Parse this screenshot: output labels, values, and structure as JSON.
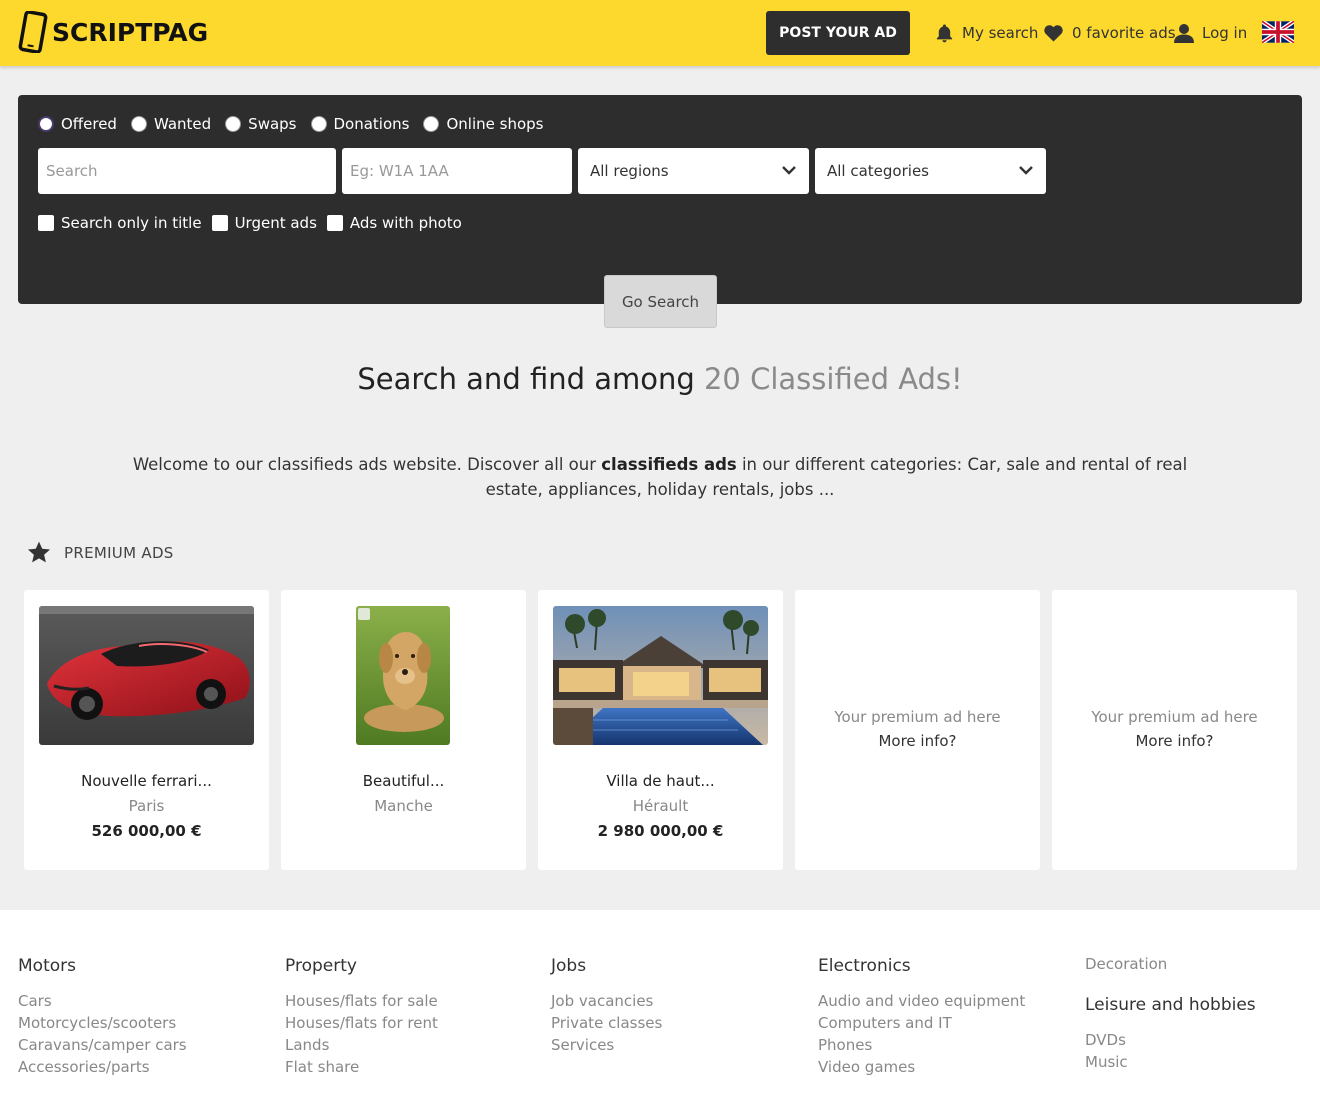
{
  "header": {
    "logo_text": "SCRIPTPAG",
    "post_ad_label": "POST YOUR AD",
    "my_search_label": "My search",
    "favorites_label": "0 favorite ads",
    "login_label": "Log in"
  },
  "search": {
    "ad_types": [
      "Offered",
      "Wanted",
      "Swaps",
      "Donations",
      "Online shops"
    ],
    "selected_ad_type": "Offered",
    "keyword_placeholder": "Search",
    "postcode_placeholder": "Eg: W1A 1AA",
    "region_value": "All regions",
    "category_value": "All categories",
    "filters": [
      "Search only in title",
      "Urgent ads",
      "Ads with photo"
    ],
    "go_label": "Go Search"
  },
  "headline": {
    "main": "Search and find among",
    "accent": "20 Classified Ads!"
  },
  "welcome": {
    "before": "Welcome to our classifieds ads website. Discover all our ",
    "bold": "classifieds ads",
    "after": " in our different categories: Car, sale and rental of real estate, appliances, holiday rentals, jobs ..."
  },
  "premium": {
    "title": "PREMIUM ADS",
    "ads": [
      {
        "title": "Nouvelle ferrari...",
        "city": "Paris",
        "price": "526 000,00 €"
      },
      {
        "title": "Beautiful...",
        "city": "Manche",
        "price": ""
      },
      {
        "title": "Villa de haut...",
        "city": "Hérault",
        "price": "2 980 000,00 €"
      }
    ],
    "placeholder_text": "Your premium ad here",
    "placeholder_link": "More info?"
  },
  "footer": {
    "columns": [
      {
        "heading": "Motors",
        "links": [
          "Cars",
          "Motorcycles/scooters",
          "Caravans/camper cars",
          "Accessories/parts"
        ]
      },
      {
        "heading": "Property",
        "links": [
          "Houses/flats for sale",
          "Houses/flats for rent",
          "Lands",
          "Flat share"
        ]
      },
      {
        "heading": "Jobs",
        "links": [
          "Job vacancies",
          "Private classes",
          "Services"
        ]
      },
      {
        "heading": "Electronics",
        "links": [
          "Audio and video equipment",
          "Computers and IT",
          "Phones",
          "Video games"
        ]
      },
      {
        "sub": "Decoration",
        "heading": "Leisure and hobbies",
        "links": [
          "DVDs",
          "Music"
        ]
      }
    ]
  },
  "colors": {
    "header_bg": "#fcd92c",
    "panel_bg": "#2d2d2d",
    "page_bg": "#efefef"
  }
}
